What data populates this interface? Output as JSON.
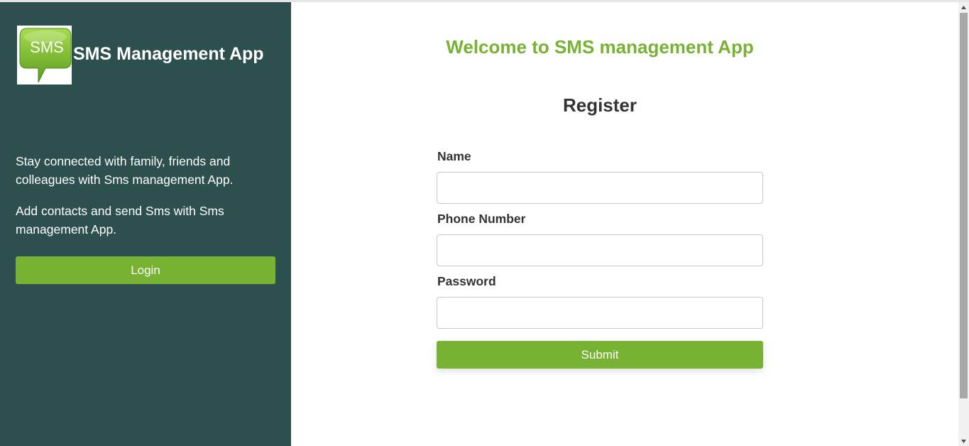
{
  "sidebar": {
    "app_name": "SMS Management App",
    "logo_text": "SMS",
    "blurb_1": "Stay connected with family, friends and colleagues with Sms management App.",
    "blurb_2": "Add contacts and send Sms with Sms management App.",
    "login_label": "Login"
  },
  "main": {
    "welcome": "Welcome to SMS management App",
    "form_title": "Register",
    "fields": [
      {
        "label": "Name",
        "value": "",
        "placeholder": ""
      },
      {
        "label": "Phone Number",
        "value": "",
        "placeholder": ""
      },
      {
        "label": "Password",
        "value": "",
        "placeholder": ""
      }
    ],
    "submit_label": "Submit"
  },
  "colors": {
    "sidebar_bg": "#2d4f4d",
    "accent_green": "#78b233",
    "heading_dark": "#333333"
  },
  "icons": {
    "logo": "sms-chat-bubble-icon",
    "scroll_up": "arrow-up-icon",
    "scroll_down": "arrow-down-icon"
  }
}
